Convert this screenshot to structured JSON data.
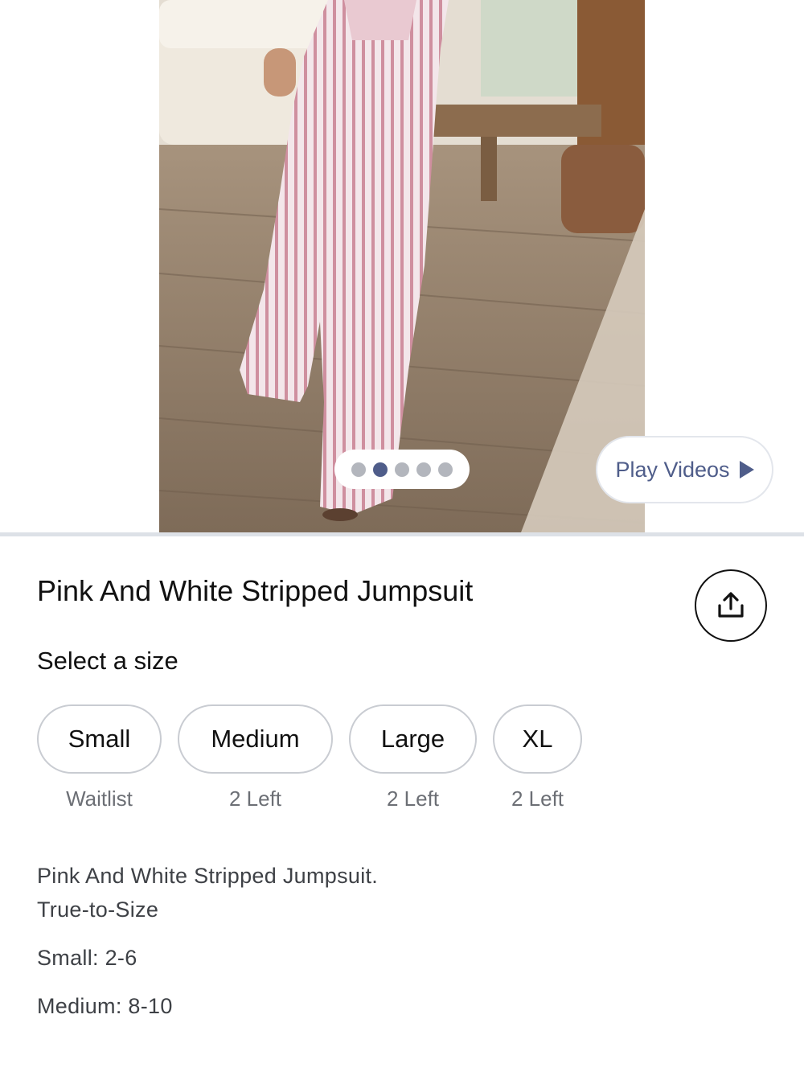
{
  "gallery": {
    "image_alt": "Woman wearing pink and white striped jumpsuit",
    "slide_count": 5,
    "active_slide": 2,
    "play_videos_label": "Play Videos"
  },
  "product": {
    "title": "Pink And White Stripped Jumpsuit",
    "share_icon": "share-icon"
  },
  "sizes": {
    "label": "Select a size",
    "options": [
      {
        "name": "Small",
        "stock": "Waitlist"
      },
      {
        "name": "Medium",
        "stock": "2 Left"
      },
      {
        "name": "Large",
        "stock": "2 Left"
      },
      {
        "name": "XL",
        "stock": "2 Left"
      }
    ]
  },
  "description": {
    "line1": "Pink And White Stripped Jumpsuit.",
    "line2": "True-to-Size",
    "line3": "Small: 2-6",
    "line4": "Medium: 8-10"
  },
  "colors": {
    "accent": "#4f5d8a",
    "dot_inactive": "#b3b6bd",
    "border": "#c9ccd2"
  }
}
